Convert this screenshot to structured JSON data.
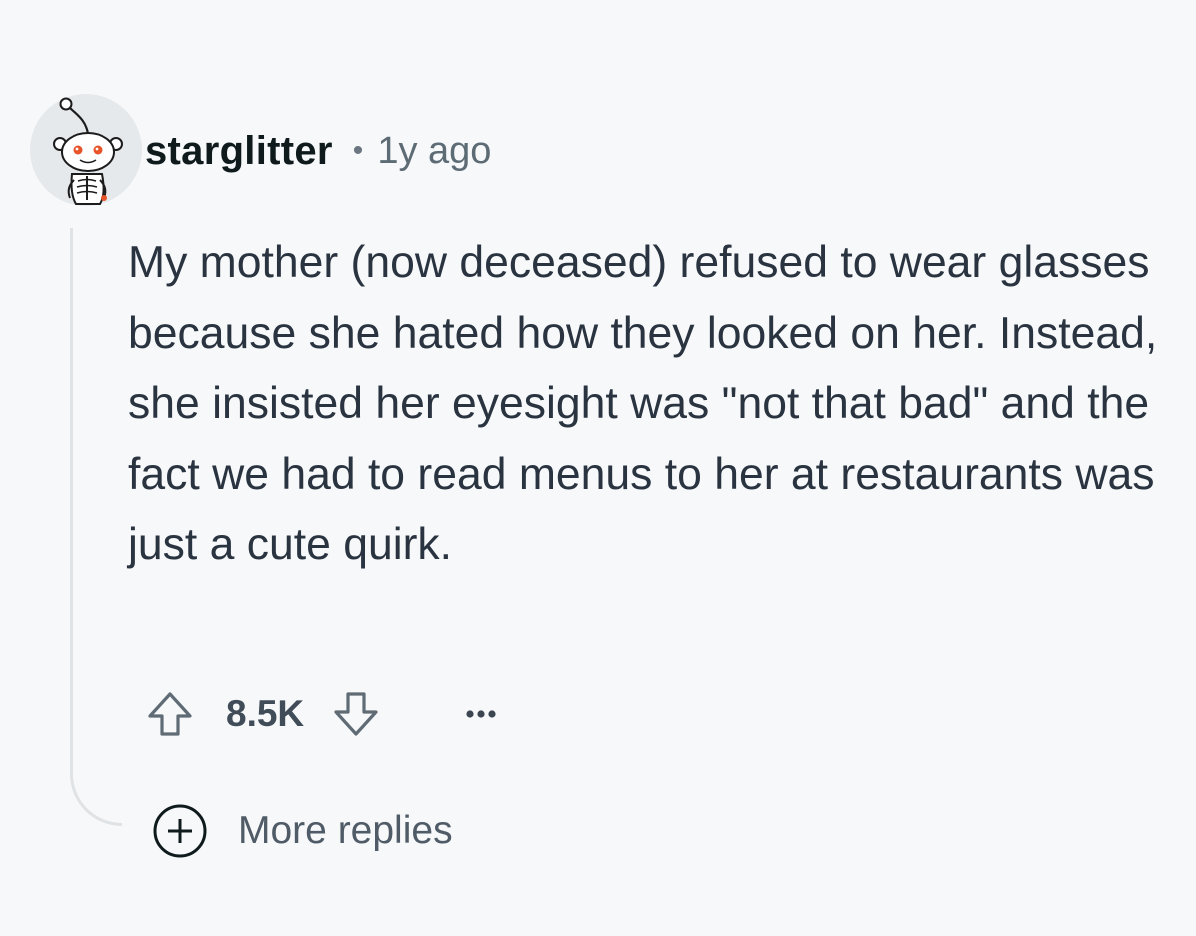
{
  "comment": {
    "author": "starglitter",
    "separator": "•",
    "timestamp": "1y ago",
    "body": "My mother (now deceased) refused to wear glasses because she hated how they looked on her. Instead, she insisted her eyesight was \"not that bad\" and the fact we had to read menus to her at restaurants was just a cute quirk.",
    "avatar_icon": "snoo-skeleton-avatar",
    "actions": {
      "upvote_icon": "arrow-up-icon",
      "score": "8.5K",
      "downvote_icon": "arrow-down-icon",
      "more_icon": "ellipsis-icon"
    }
  },
  "more_replies": {
    "icon": "plus-circle-icon",
    "label": "More replies"
  },
  "colors": {
    "background": "#f7f8fa",
    "text": "#2a3440",
    "muted": "#5d6b75",
    "thread_line": "#dfe3e6"
  }
}
